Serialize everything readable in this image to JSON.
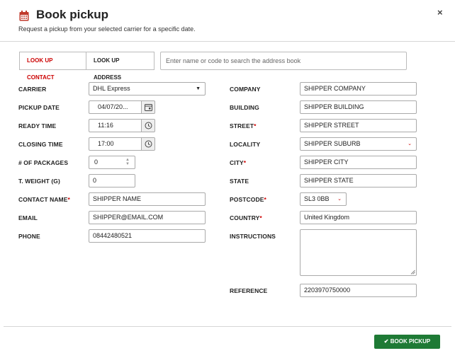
{
  "header": {
    "title": "Book pickup",
    "subtitle": "Request a pickup from your selected carrier for a specific date.",
    "close_symbol": "×"
  },
  "lookup": {
    "contact_tab": "LOOK UP CONTACT",
    "address_tab": "LOOK UP ADDRESS",
    "search_placeholder": "Enter name or code to search the address book"
  },
  "left": {
    "carrier": {
      "label": "CARRIER",
      "value": "DHL Express"
    },
    "pickup_date": {
      "label": "PICKUP DATE",
      "value": "04/07/20..."
    },
    "ready_time": {
      "label": "READY TIME",
      "value": "11:16"
    },
    "closing_time": {
      "label": "CLOSING TIME",
      "value": "17:00"
    },
    "packages": {
      "label": "# OF PACKAGES",
      "value": "0"
    },
    "weight": {
      "label": "T. WEIGHT (G)",
      "value": "0"
    },
    "contact_name": {
      "label": "CONTACT NAME",
      "value": "SHIPPER NAME"
    },
    "email": {
      "label": "EMAIL",
      "value": "SHIPPER@EMAIL.COM"
    },
    "phone": {
      "label": "PHONE",
      "value": "08442480521"
    }
  },
  "right": {
    "company": {
      "label": "COMPANY",
      "value": "SHIPPER COMPANY"
    },
    "building": {
      "label": "BUILDING",
      "value": "SHIPPER BUILDING"
    },
    "street": {
      "label": "STREET",
      "value": "SHIPPER STREET"
    },
    "locality": {
      "label": "LOCALITY",
      "value": "SHIPPER SUBURB"
    },
    "city": {
      "label": "CITY",
      "value": "SHIPPER CITY"
    },
    "state": {
      "label": "STATE",
      "value": "SHIPPER STATE"
    },
    "postcode": {
      "label": "POSTCODE",
      "value": "SL3 0BB"
    },
    "country": {
      "label": "COUNTRY",
      "value": "United Kingdom"
    },
    "instructions": {
      "label": "INSTRUCTIONS",
      "value": ""
    },
    "reference": {
      "label": "REFERENCE",
      "value": "2203970750000"
    }
  },
  "required_mark": "*",
  "footer": {
    "book_label": "BOOK PICKUP",
    "check_symbol": "✔"
  },
  "colors": {
    "accent_red": "#cc0000",
    "primary_green": "#1e7a35"
  },
  "icons": [
    "calendar-icon",
    "close-icon",
    "clock-icon",
    "check-icon",
    "caret-down-icon"
  ]
}
